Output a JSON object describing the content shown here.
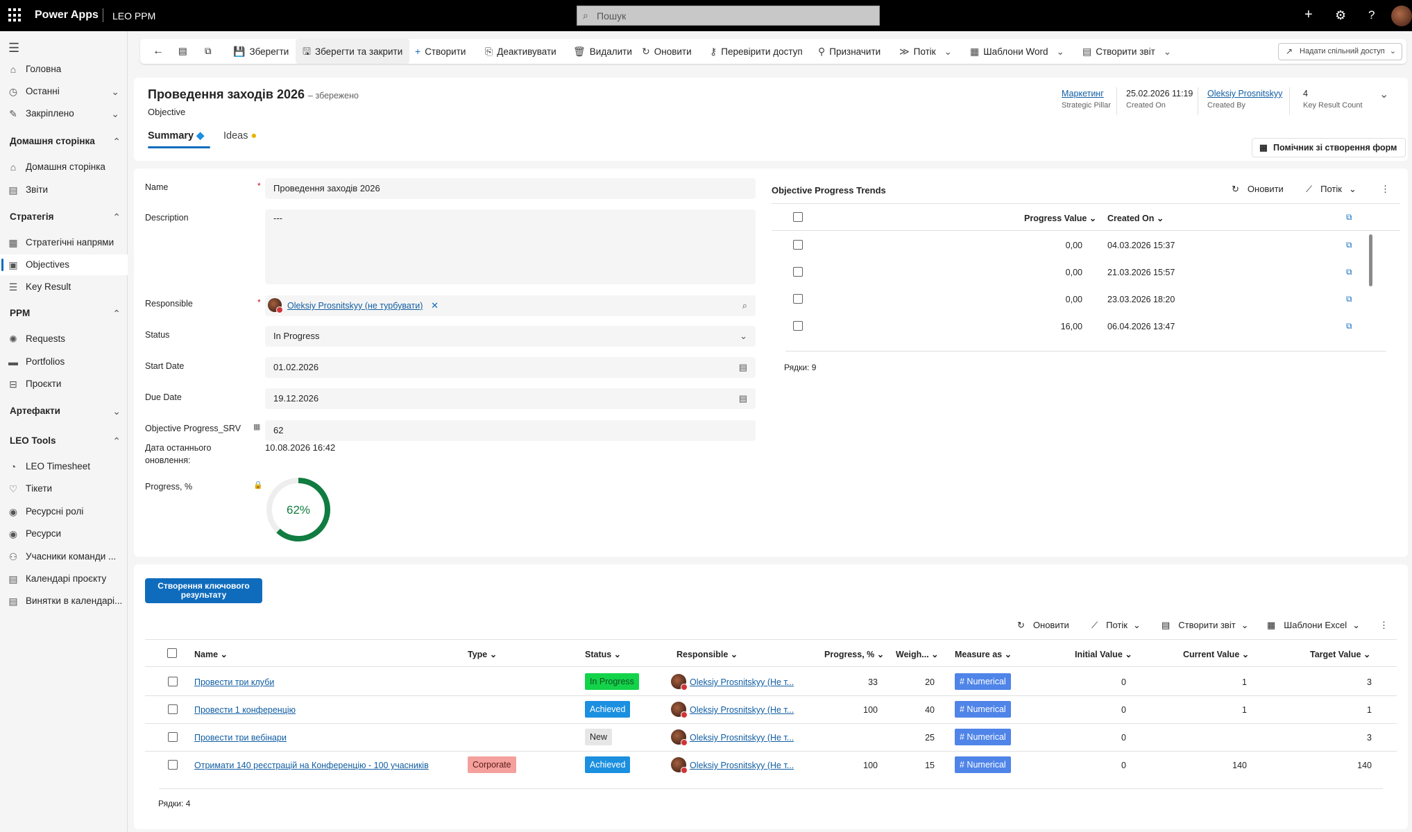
{
  "app": {
    "brand": "Power Apps",
    "env": "LEO PPM",
    "search_placeholder": "Пошук"
  },
  "sidebar": {
    "items": [
      {
        "label": "Головна",
        "icon": "home-icon"
      },
      {
        "label": "Останні",
        "icon": "clock-icon"
      },
      {
        "label": "Закріплено",
        "icon": "pin-icon"
      }
    ],
    "sections": [
      {
        "title": "Домашня сторінка",
        "items": [
          "Домашня сторінка",
          "Звіти"
        ]
      },
      {
        "title": "Стратегія",
        "items": [
          "Стратегічні напрями",
          "Objectives",
          "Key Result"
        ]
      },
      {
        "title": "PPM",
        "items": [
          "Requests",
          "Portfolios",
          "Проєкти"
        ]
      },
      {
        "title": "Артефакти",
        "items": []
      },
      {
        "title": "LEO Tools",
        "items": [
          "LEO Timesheet",
          "Тікети",
          "Ресурсні ролі",
          "Ресурси",
          "Учасники команди ...",
          "Календарі проєкту",
          "Винятки в календарі..."
        ]
      }
    ]
  },
  "commands": [
    "Зберегти",
    "Зберегти та закрити",
    "Створити",
    "Деактивувати",
    "Видалити",
    "Оновити",
    "Перевірити доступ",
    "Призначити",
    "Потік",
    "Шаблони Word",
    "Створити звіт"
  ],
  "share": "Надати спільний доступ",
  "record": {
    "title": "Проведення заходів 2026",
    "saved": "– збережено",
    "entity": "Objective",
    "tabs": [
      "Summary",
      "Ideas"
    ],
    "header_fields": [
      {
        "value": "Маркетинг",
        "label": "Strategic Pillar"
      },
      {
        "value": "25.02.2026 11:19",
        "label": "Created On"
      },
      {
        "value": "Oleksiy Prosnitskyy",
        "label": "Created By"
      },
      {
        "value": "4",
        "label": "Key Result Count"
      }
    ],
    "form_helper": "Помічник зі створення форм"
  },
  "form": {
    "name_label": "Name",
    "name": "Проведення заходів 2026",
    "description_label": "Description",
    "description": "---",
    "responsible_label": "Responsible",
    "responsible": "Oleksiy Prosnitskyy (не турбувати)",
    "status_label": "Status",
    "status": "In Progress",
    "start_label": "Start Date",
    "start": "01.02.2026",
    "due_label": "Due Date",
    "due": "19.12.2026",
    "srv_label": "Objective Progress_SRV",
    "srv": "62",
    "last_update_label": "Дата останнього оновлення:",
    "last_update": "10.08.2026 16:42",
    "progress_label": "Progress, %",
    "progress_text": "62%",
    "progress_value": 62
  },
  "trends": {
    "title": "Objective Progress Trends",
    "refresh": "Оновити",
    "flow": "Потік",
    "columns": [
      "Progress Value",
      "Created On"
    ],
    "rows": [
      {
        "value": "0,00",
        "created": "04.03.2026 15:37"
      },
      {
        "value": "0,00",
        "created": "21.03.2026 15:57"
      },
      {
        "value": "0,00",
        "created": "23.03.2026 18:20"
      },
      {
        "value": "16,00",
        "created": "06.04.2026 13:47"
      }
    ],
    "count": "Рядки: 9"
  },
  "keyresults": {
    "create_button": "Створення ключового результату",
    "actions": [
      "Оновити",
      "Потік",
      "Створити звіт",
      "Шаблони Excel"
    ],
    "columns": [
      "Name",
      "Type",
      "Status",
      "Responsible",
      "Progress, %",
      "Weigh...",
      "Measure as",
      "Initial Value",
      "Current Value",
      "Target Value"
    ],
    "rows": [
      {
        "name": "Провести три клуби",
        "type": "",
        "status": "In Progress",
        "responsible": "Oleksiy Prosnitskyy (Не т...",
        "progress": "33",
        "weight": "20",
        "measure": "# Numerical",
        "initial": "0",
        "current": "1",
        "target": "3"
      },
      {
        "name": "Провести 1 конференцію",
        "type": "",
        "status": "Achieved",
        "responsible": "Oleksiy Prosnitskyy (Не т...",
        "progress": "100",
        "weight": "40",
        "measure": "# Numerical",
        "initial": "0",
        "current": "1",
        "target": "1"
      },
      {
        "name": "Провести три вебінари",
        "type": "",
        "status": "New",
        "responsible": "Oleksiy Prosnitskyy (Не т...",
        "progress": "",
        "weight": "25",
        "measure": "# Numerical",
        "initial": "0",
        "current": "",
        "target": "3"
      },
      {
        "name": "Отримати 140 реєстрацій на Конференцію - 100 учасників",
        "type": "Corporate",
        "status": "Achieved",
        "responsible": "Oleksiy Prosnitskyy (Не т...",
        "progress": "100",
        "weight": "15",
        "measure": "# Numerical",
        "initial": "0",
        "current": "140",
        "target": "140"
      }
    ],
    "count": "Рядки: 4"
  },
  "colors": {
    "accent": "#0f6cbd",
    "in_progress": "#13d34a",
    "achieved": "#1b8fe0",
    "new": "#e6e6e6",
    "corporate": "#f4a09c",
    "numerical": "#4f84e8",
    "gauge": "#107c41"
  }
}
